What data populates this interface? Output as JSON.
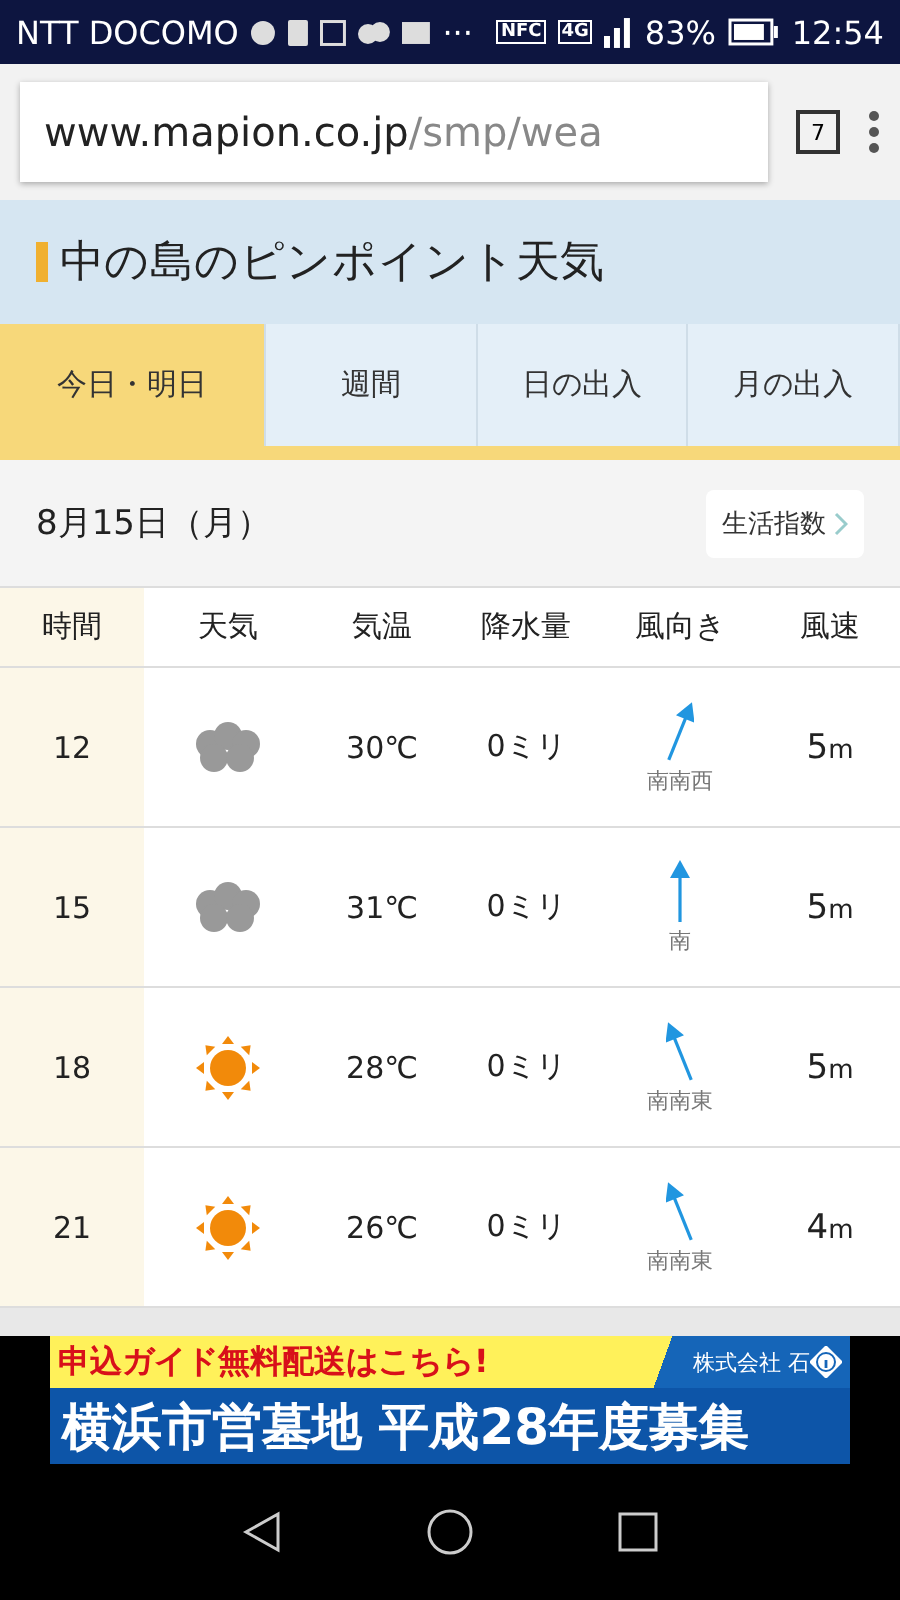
{
  "status_bar": {
    "carrier": "NTT DOCOMO",
    "notification_more": "···",
    "nfc": "NFC",
    "network": "4G",
    "battery": "83%",
    "time": "12:54"
  },
  "browser": {
    "url_host": "www.mapion.co.jp",
    "url_path": "/smp/wea",
    "tab_count": "7"
  },
  "page": {
    "title": "中の島のピンポイント天気",
    "tabs": [
      {
        "label": "今日・明日",
        "selected": true
      },
      {
        "label": "週間",
        "selected": false
      },
      {
        "label": "日の出入",
        "selected": false
      },
      {
        "label": "月の出入",
        "selected": false
      }
    ],
    "date": "8月15日（月）",
    "index_button": "生活指数",
    "table": {
      "columns": [
        "時間",
        "天気",
        "気温",
        "降水量",
        "風向き",
        "風速"
      ],
      "rows": [
        {
          "time": "12",
          "kind": "cloudy",
          "temp": "30℃",
          "rain": "0ミリ",
          "wind": {
            "kind": "ssw",
            "direction": "南南西"
          },
          "wind_speed": "5",
          "unit": "m"
        },
        {
          "time": "15",
          "kind": "cloudy",
          "temp": "31℃",
          "rain": "0ミリ",
          "wind": {
            "kind": "s",
            "direction": "南"
          },
          "wind_speed": "5",
          "unit": "m"
        },
        {
          "time": "18",
          "kind": "sunny",
          "temp": "28℃",
          "rain": "0ミリ",
          "wind": {
            "kind": "sse",
            "direction": "南南東"
          },
          "wind_speed": "5",
          "unit": "m"
        },
        {
          "time": "21",
          "kind": "sunny",
          "temp": "26℃",
          "rain": "0ミリ",
          "wind": {
            "kind": "sse",
            "direction": "南南東"
          },
          "wind_speed": "4",
          "unit": "m"
        }
      ]
    }
  },
  "ad": {
    "headline": "申込ガイド無料配送はこちら!",
    "company": "株式会社 石",
    "banner": "横浜市営墓地 平成28年度募集"
  }
}
